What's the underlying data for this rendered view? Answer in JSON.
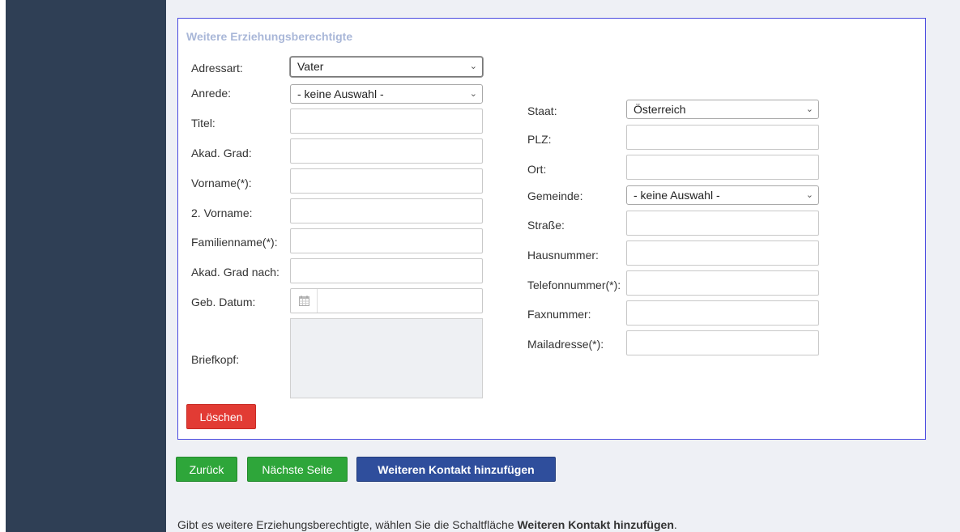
{
  "panel": {
    "title": "Weitere Erziehungsberechtigte"
  },
  "left": {
    "adressart_label": "Adressart:",
    "adressart_value": "Vater",
    "anrede_label": "Anrede:",
    "anrede_value": "- keine Auswahl -",
    "titel_label": "Titel:",
    "akad_grad_label": "Akad. Grad:",
    "vorname_label": "Vorname(*):",
    "vorname2_label": "2. Vorname:",
    "familienname_label": "Familienname(*):",
    "akad_grad_nach_label": "Akad. Grad nach:",
    "geb_datum_label": "Geb. Datum:",
    "briefkopf_label": "Briefkopf:"
  },
  "right": {
    "staat_label": "Staat:",
    "staat_value": "Österreich",
    "plz_label": "PLZ:",
    "ort_label": "Ort:",
    "gemeinde_label": "Gemeinde:",
    "gemeinde_value": "- keine Auswahl -",
    "strasse_label": "Straße:",
    "hausnummer_label": "Hausnummer:",
    "telefon_label": "Telefonnummer(*):",
    "fax_label": "Faxnummer:",
    "mail_label": "Mailadresse(*):"
  },
  "buttons": {
    "loeschen": "Löschen",
    "zurueck": "Zurück",
    "naechste": "Nächste Seite",
    "kontakt": "Weiteren Kontakt hinzufügen"
  },
  "footer": {
    "text_before": "Gibt es weitere Erziehungsberechtigte, wählen Sie die Schaltfläche ",
    "text_bold": "Weiteren Kontakt hinzufügen",
    "text_after": "."
  },
  "icons": {
    "chevron": "chevron-down-icon",
    "calendar": "calendar-icon"
  },
  "colors": {
    "sidebar": "#2f3f55",
    "panel_border": "#4a4ae0",
    "delete": "#e23b34",
    "green": "#2ea63a",
    "blue": "#2f4e9c"
  }
}
